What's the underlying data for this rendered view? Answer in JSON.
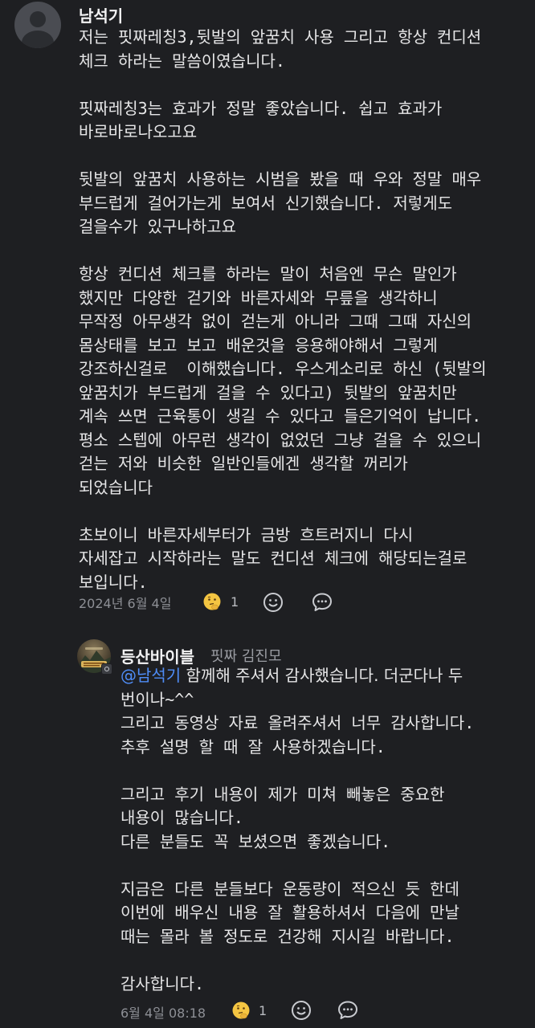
{
  "comments": [
    {
      "author": "남석기",
      "body": "저는 핏짜레칭3,뒷발의 앞꿈치 사용 그리고 항상 컨디션\n체크 하라는 말씀이였습니다.\n\n핏짜레칭3는 효과가 정말 좋았습니다. 쉽고 효과가\n바로바로나오고요\n\n뒷발의 앞꿈치 사용하는 시범을 봤을 때 우와 정말 매우\n부드럽게 걸어가는게 보여서 신기했습니다. 저렇게도\n걸을수가 있구나하고요\n\n항상 컨디션 체크를 하라는 말이 처음엔 무슨 말인가\n했지만 다양한 걷기와 바른자세와 무릎을 생각하니\n무작정 아무생각 없이 걷는게 아니라 그때 그때 자신의\n몸상태를 보고 보고 배운것을 응용해야해서 그렇게\n강조하신걸로  이해했습니다. 우스게소리로 하신 (뒷발의\n앞꿈치가 부드럽게 걸을 수 있다고) 뒷발의 앞꿈치만\n계속 쓰면 근육통이 생길 수 있다고 들은기억이 납니다.\n평소 스텝에 아무런 생각이 없었던 그냥 걸을 수 있으니\n걷는 저와 비슷한 일반인들에겐 생각할 꺼리가\n되었습니다\n\n초보이니 바른자세부터가 금방 흐트러지니 다시\n자세잡고 시작하라는 말도 컨디션 체크에 해당되는걸로\n보입니다.",
      "date": "2024년 6월 4일",
      "reaction_count": "1",
      "icons": {
        "avatar": "default-user-avatar-icon",
        "reaction": "thinking-face-emoji-icon",
        "add_reaction": "smiley-face-icon",
        "reply": "speech-bubble-icon"
      }
    },
    {
      "author": "등산바이블",
      "role": "핏짜 김진모",
      "mention": "@남석기",
      "body_first": " 함께해 주셔서 감사했습니다. 더군다나 두",
      "body": "번이나~^^\n그리고 동영상 자료 올려주셔서 너무 감사합니다.\n추후 설명 할 때 잘 사용하겠습니다.\n\n그리고 후기 내용이 제가 미쳐 빼놓은 중요한\n내용이 많습니다.\n다른 분들도 꼭 보셨으면 좋겠습니다.\n\n지금은 다른 분들보다 운동량이 적으신 듯 한데\n이번에 배우신 내용 잘 활용하셔서 다음에 만날\n때는 몰라 볼 정도로 건강해 지시길 바랍니다.\n\n감사합니다.",
      "date": "6월 4일 08:18",
      "reaction_count": "1",
      "icons": {
        "avatar": "brand-avatar-icon",
        "badge": "manager-badge-icon",
        "reaction": "thinking-face-emoji-icon",
        "add_reaction": "smiley-face-icon",
        "reply": "speech-bubble-icon"
      }
    }
  ],
  "colors": {
    "background": "#1e1f22",
    "mention": "#4f8df7",
    "emoji": "#f4c542"
  }
}
